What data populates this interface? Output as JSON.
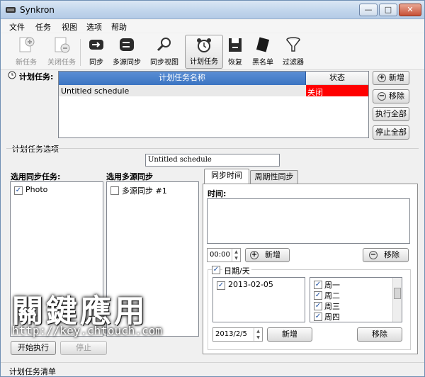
{
  "window": {
    "title": "Synkron",
    "min": "—",
    "max": "□",
    "close": "✕"
  },
  "menu": [
    "文件",
    "任务",
    "视图",
    "选项",
    "帮助"
  ],
  "toolbar": {
    "new_task": "新任务",
    "close_task": "关闭任务",
    "sync": "同步",
    "multisync": "多源同步",
    "sync_view": "同步视图",
    "scheduler": "计划任务",
    "restore": "恢复",
    "blacklist": "黑名单",
    "filters": "过滤器"
  },
  "schedules": {
    "label": "计划任务:",
    "col_name": "计划任务名称",
    "col_status": "状态",
    "rows": [
      {
        "name": "Untitled schedule",
        "status": "关闭",
        "status_color": "#ff0000"
      }
    ],
    "add": "新增",
    "remove": "移除",
    "run_all": "执行全部",
    "stop_all": "停止全部"
  },
  "options": {
    "label": "计划任务选项",
    "name_value": "Untitled schedule",
    "sync_label": "选用同步任务:",
    "sync_items": [
      {
        "label": "Photo",
        "checked": true
      }
    ],
    "multisync_label": "选用多源同步",
    "multisync_items": [
      {
        "label": "多源同步 #1",
        "checked": false
      }
    ],
    "start": "开始执行",
    "stop": "停止"
  },
  "timing": {
    "tabs": [
      "同步时间",
      "周期性同步"
    ],
    "time_label": "时间:",
    "time_value": "00:00",
    "add": "新增",
    "remove": "移除",
    "date_label": "日期/天",
    "date_checked": true,
    "dates": [
      {
        "label": "2013-02-05",
        "checked": true
      }
    ],
    "weekdays": [
      {
        "label": "周一",
        "checked": true
      },
      {
        "label": "周二",
        "checked": true
      },
      {
        "label": "周三",
        "checked": true
      },
      {
        "label": "周四",
        "checked": true
      }
    ],
    "date_value": "2013/2/5",
    "date_add": "新增",
    "date_remove": "移除"
  },
  "watermark": {
    "title": "關鍵應用",
    "url": "http://key.chtouch.com"
  },
  "status_bar": "计划任务清单"
}
